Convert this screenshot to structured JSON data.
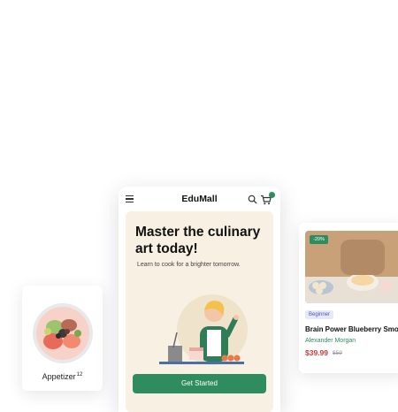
{
  "category_card": {
    "label": "Appetizer",
    "count": "12"
  },
  "phone": {
    "brand": "EduMall",
    "cart_count": "",
    "hero": {
      "title": "Master the culinary art today!",
      "subtitle": "Learn to cook for a brighter tomorrow.",
      "cta": "Get Started"
    }
  },
  "course_card": {
    "discount": "-20%",
    "level": "Beginner",
    "title": "Brain Power Blueberry Smoo",
    "author": "Alexander Morgan",
    "price": "$39.99",
    "old_price": "$59"
  },
  "colors": {
    "accent": "#2e8c5f",
    "hero_bg": "#f8f0e2",
    "price": "#d13a3a",
    "level_bg": "#e7e9fb"
  },
  "icons": [
    "hamburger-icon",
    "search-icon",
    "cart-icon"
  ]
}
